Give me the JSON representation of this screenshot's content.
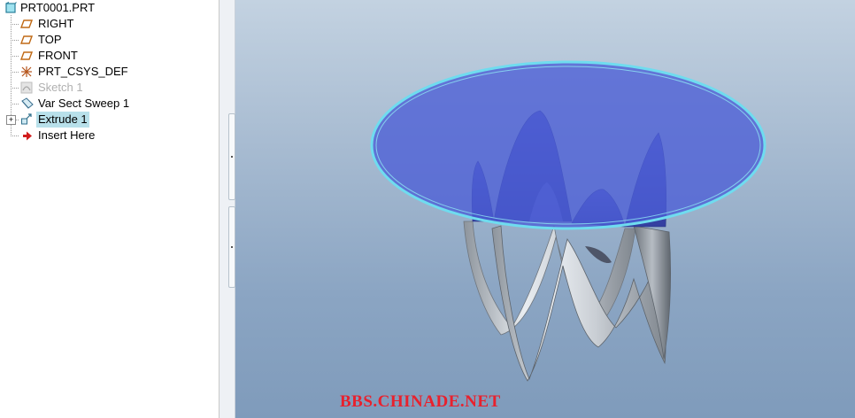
{
  "model_tree": {
    "root": {
      "label": "PRT0001.PRT",
      "icon": "part-icon"
    },
    "items": [
      {
        "label": "RIGHT",
        "icon": "datum-plane-icon",
        "state": "normal"
      },
      {
        "label": "TOP",
        "icon": "datum-plane-icon",
        "state": "normal"
      },
      {
        "label": "FRONT",
        "icon": "datum-plane-icon",
        "state": "normal"
      },
      {
        "label": "PRT_CSYS_DEF",
        "icon": "coordinate-system-icon",
        "state": "normal"
      },
      {
        "label": "Sketch 1",
        "icon": "sketch-icon",
        "state": "suppressed"
      },
      {
        "label": "Var Sect Sweep 1",
        "icon": "sweep-icon",
        "state": "normal"
      },
      {
        "label": "Extrude 1",
        "icon": "extrude-icon",
        "state": "selected",
        "expandable": true
      },
      {
        "label": "Insert Here",
        "icon": "insert-arrow-icon",
        "state": "normal"
      }
    ]
  },
  "viewport": {
    "watermark": "BBS.CHINADE.NET",
    "model": "glass-table-top-on-wavy-sweep-base"
  },
  "colors": {
    "selected_highlight": "#b8e0ea",
    "suppressed_text": "#b0b0b0",
    "glass_top": "#4c5ed6",
    "glass_edge": "#6fdcef",
    "watermark": "#e8212d"
  }
}
